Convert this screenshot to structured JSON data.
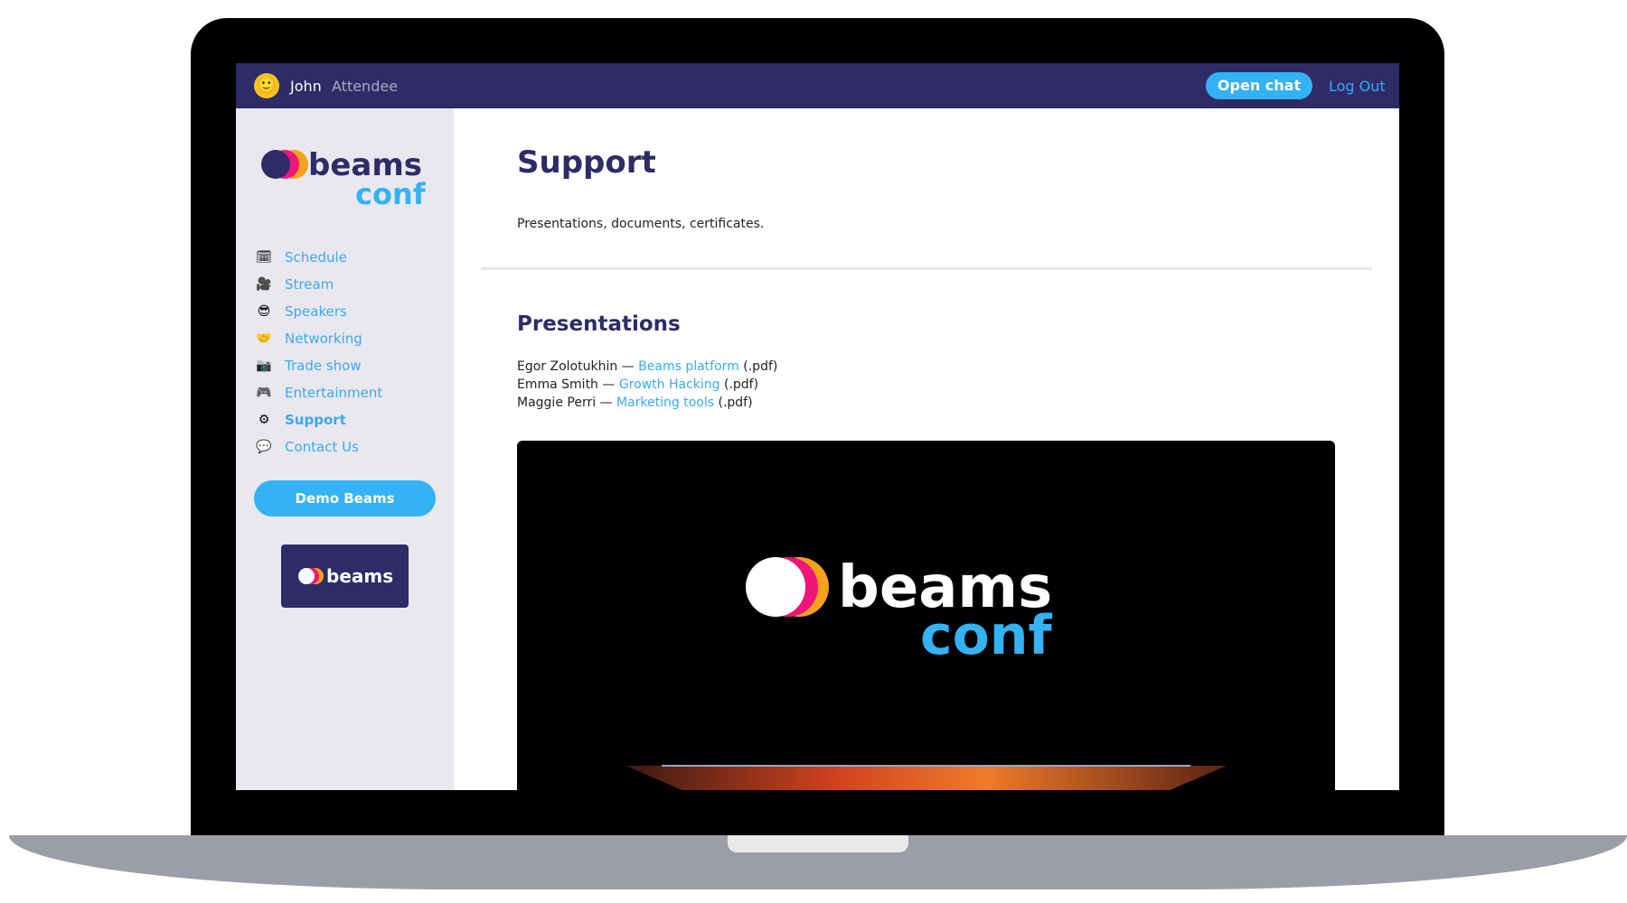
{
  "header": {
    "user_emoji": "🙂",
    "user_name": "John",
    "user_role": "Attendee",
    "open_chat_label": "Open chat",
    "logout_label": "Log Out"
  },
  "sidebar": {
    "logo": {
      "word1": "beams",
      "word2": "conf"
    },
    "items": [
      {
        "icon": "calendar-icon",
        "glyph": "🗓",
        "label": "Schedule"
      },
      {
        "icon": "video-camera-icon",
        "glyph": "🎥",
        "label": "Stream"
      },
      {
        "icon": "sunglasses-emoji-icon",
        "glyph": "😎",
        "label": "Speakers"
      },
      {
        "icon": "handshake-icon",
        "glyph": "🤝",
        "label": "Networking"
      },
      {
        "icon": "camera-icon",
        "glyph": "📷",
        "label": "Trade show"
      },
      {
        "icon": "gamepad-icon",
        "glyph": "🎮",
        "label": "Entertainment"
      },
      {
        "icon": "gear-icon",
        "glyph": "⚙",
        "label": "Support",
        "active": true
      },
      {
        "icon": "speech-bubble-icon",
        "glyph": "💬",
        "label": "Contact Us"
      }
    ],
    "demo_button_label": "Demo Beams",
    "badge_word": "beams"
  },
  "main": {
    "title": "Support",
    "subtitle": "Presentations, documents, certificates.",
    "section_title": "Presentations",
    "presentations": [
      {
        "author": "Egor Zolotukhin",
        "link": "Beams platform",
        "suffix": "(.pdf)"
      },
      {
        "author": "Emma Smith",
        "link": "Growth Hacking",
        "suffix": "(.pdf)"
      },
      {
        "author": "Maggie Perri",
        "link": "Marketing tools",
        "suffix": "(.pdf)"
      }
    ],
    "video_logo": {
      "word1": "beams",
      "word2": "conf"
    }
  },
  "colors": {
    "navy": "#2e2b67",
    "accent_blue": "#33b3f3",
    "pink": "#f0157a",
    "orange": "#f7a21b",
    "sidebar_bg": "#e9e8ef"
  }
}
